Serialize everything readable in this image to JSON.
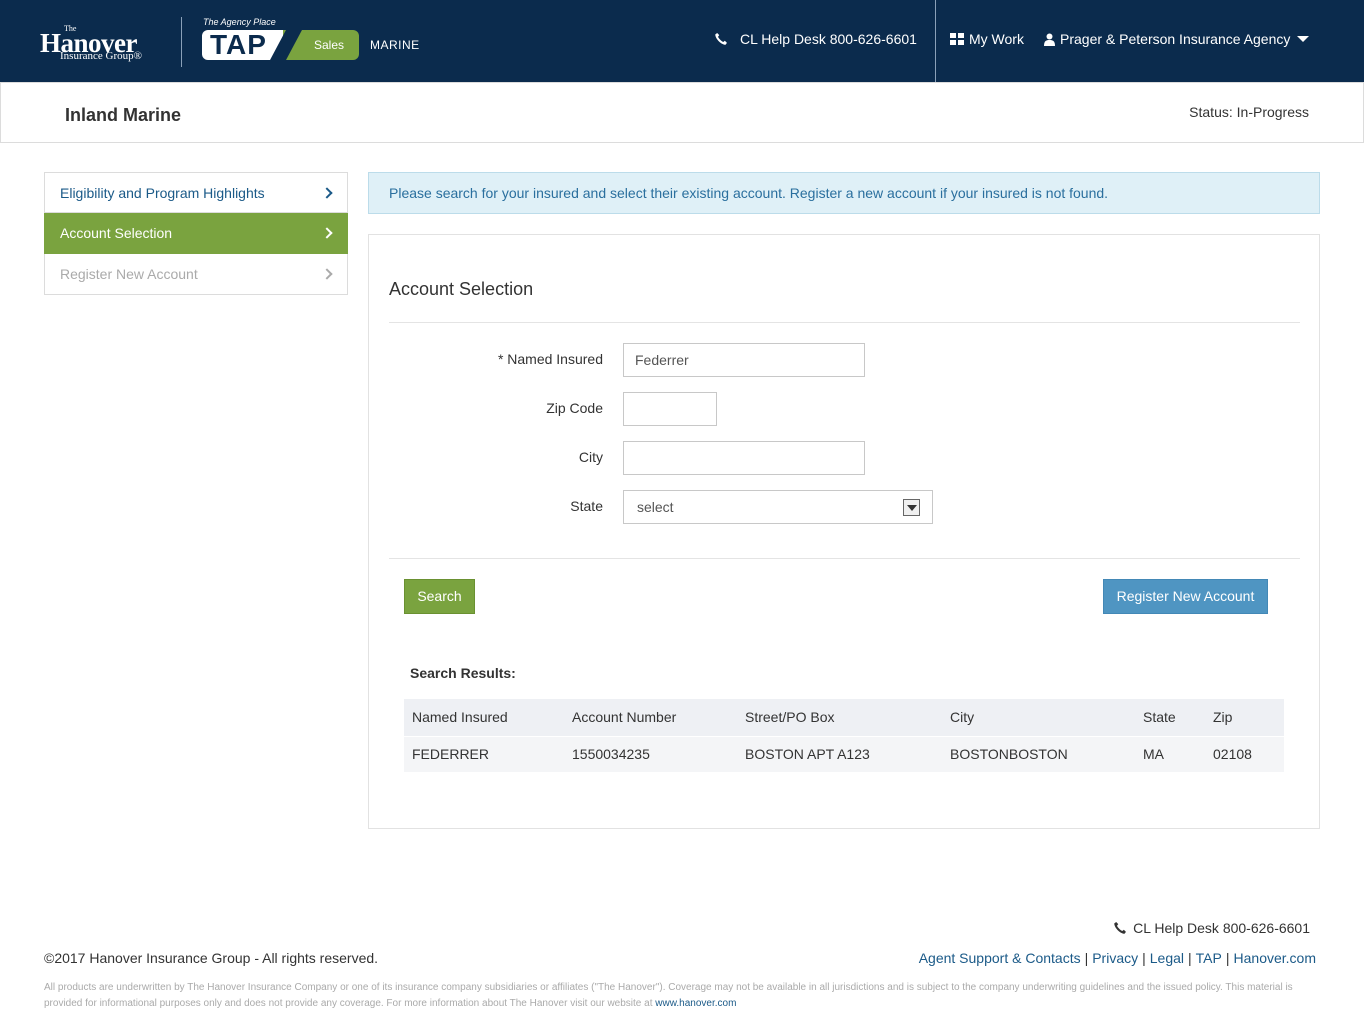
{
  "header": {
    "logo": {
      "the": "The",
      "name": "Hanover",
      "group": "Insurance Group®"
    },
    "tap_caption": "The Agency Place",
    "tap_label": "TAP",
    "tap_sales": "Sales",
    "product_line": "MARINE",
    "help_desk": "CL Help Desk 800-626-6601",
    "my_work": "My Work",
    "agency": "Prager & Peterson Insurance Agency",
    "colors": {
      "navy": "#0b2b4d",
      "green": "#7aa33f"
    }
  },
  "title_bar": {
    "title": "Inland Marine",
    "status": "Status: In-Progress"
  },
  "sidebar": {
    "items": [
      {
        "label": "Eligibility and Program Highlights",
        "state": "link"
      },
      {
        "label": "Account Selection",
        "state": "active"
      },
      {
        "label": "Register New Account",
        "state": "disabled"
      }
    ]
  },
  "alert": {
    "text": "Please search for your insured and select their existing account. Register a new account if your insured is not found."
  },
  "form": {
    "heading": "Account Selection",
    "named_insured": {
      "label": "* Named Insured",
      "value": "Federrer"
    },
    "zip": {
      "label": "Zip Code",
      "value": ""
    },
    "city": {
      "label": "City",
      "value": ""
    },
    "state": {
      "label": "State",
      "value": "select"
    },
    "search_button": "Search",
    "register_button": "Register New Account"
  },
  "results": {
    "label": "Search Results:",
    "columns": [
      "Named Insured",
      "Account Number",
      "Street/PO Box",
      "City",
      "State",
      "Zip"
    ],
    "rows": [
      [
        "FEDERRER",
        "1550034235",
        "BOSTON APT A123",
        "BOSTONBOSTON",
        "MA",
        "02108"
      ]
    ]
  },
  "footer": {
    "help_desk": "CL Help Desk 800-626-6601",
    "copyright": "©2017 Hanover Insurance Group - All rights reserved.",
    "links": [
      "Agent Support & Contacts",
      "Privacy",
      "Legal",
      "TAP",
      "Hanover.com"
    ],
    "disclaimer": "All products are underwritten by The Hanover Insurance Company or one of its insurance company subsidiaries or affiliates (\"The Hanover\"). Coverage may not be available in all jurisdictions and is subject to the company underwriting guidelines and the issued policy. This material is provided for informational purposes only and does not provide any coverage. For more information about The Hanover visit our website at",
    "website": "www.hanover.com"
  }
}
